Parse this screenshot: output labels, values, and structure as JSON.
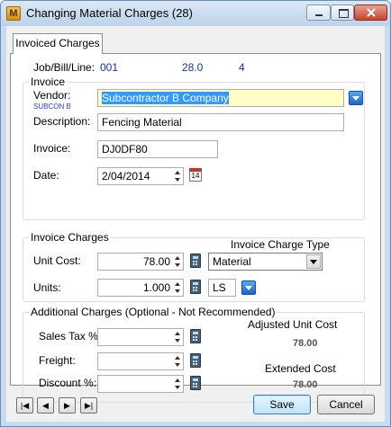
{
  "window": {
    "app_icon_letter": "M",
    "title": "Changing Material Charges  (28)"
  },
  "tab": {
    "label": "Invoiced Charges"
  },
  "header": {
    "job_bill_line_label": "Job/Bill/Line:",
    "job": "001",
    "bill": "28.0",
    "line": "4"
  },
  "invoice": {
    "group_title": "Invoice",
    "vendor_label": "Vendor:",
    "vendor_code": "SUBCON B",
    "vendor_value": "Subcontractor B Company",
    "description_label": "Description:",
    "description_value": "Fencing Material",
    "invoice_label": "Invoice:",
    "invoice_value": "DJ0DF80",
    "date_label": "Date:",
    "date_value": "2/04/2014",
    "calendar_day": "14"
  },
  "charges": {
    "group_title": "Invoice Charges",
    "type_label": "Invoice Charge Type",
    "unit_cost_label": "Unit Cost:",
    "unit_cost_value": "78.00",
    "type_value": "Material",
    "units_label": "Units:",
    "units_value": "1.000",
    "unit_of_measure": "LS"
  },
  "additional": {
    "group_title": "Additional Charges (Optional - Not Recommended)",
    "sales_tax_label": "Sales Tax %",
    "sales_tax_value": "",
    "freight_label": "Freight:",
    "freight_value": "",
    "discount_label": "Discount %:",
    "discount_value": "",
    "adjusted_unit_cost_label": "Adjusted Unit Cost",
    "adjusted_unit_cost_value": "78.00",
    "extended_cost_label": "Extended Cost",
    "extended_cost_value": "78.00"
  },
  "footer": {
    "nav_first": "|◀",
    "nav_prev": "◀",
    "nav_next": "▶",
    "nav_last": "▶|",
    "save_label": "Save",
    "cancel_label": "Cancel"
  }
}
